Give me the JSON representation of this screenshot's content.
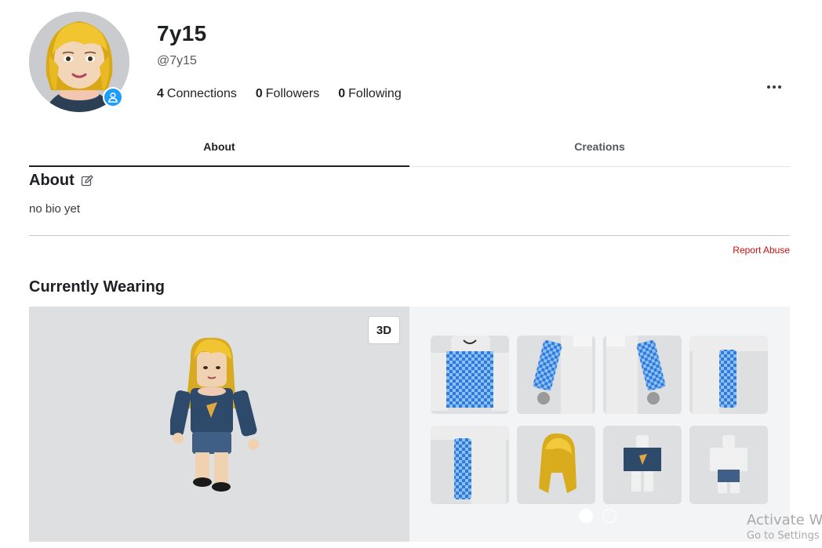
{
  "profile": {
    "display_name": "7y15",
    "username": "@7y15",
    "presence_icon": "user-icon",
    "stats": [
      {
        "count": "4",
        "label": "Connections"
      },
      {
        "count": "0",
        "label": "Followers"
      },
      {
        "count": "0",
        "label": "Following"
      }
    ],
    "more_icon": "ellipsis-icon"
  },
  "tabs": [
    {
      "label": "About",
      "active": true
    },
    {
      "label": "Creations",
      "active": false
    }
  ],
  "about": {
    "title": "About",
    "edit_icon": "edit-icon",
    "bio": "no bio yet",
    "report_label": "Report Abuse"
  },
  "wearing": {
    "title": "Currently Wearing",
    "toggle_3d_label": "3D",
    "items": [
      {
        "name": "shirt-checkered-blue"
      },
      {
        "name": "left-sleeve-checkered-blue"
      },
      {
        "name": "right-sleeve-checkered-blue"
      },
      {
        "name": "right-leg-checkered-blue"
      },
      {
        "name": "left-leg-checkered-blue"
      },
      {
        "name": "blonde-hair"
      },
      {
        "name": "navy-sweater-outfit"
      },
      {
        "name": "jeans-outfit"
      }
    ],
    "pages": 2,
    "current_page": 1
  },
  "watermark": {
    "line1": "Activate W",
    "line2": "Go to Settings"
  },
  "colors": {
    "presence": "#1c9dff",
    "report": "#c90d0d",
    "checker_blue": "#2f7bdc",
    "hair": "#e3b62a",
    "sweater": "#2d4a6b"
  }
}
